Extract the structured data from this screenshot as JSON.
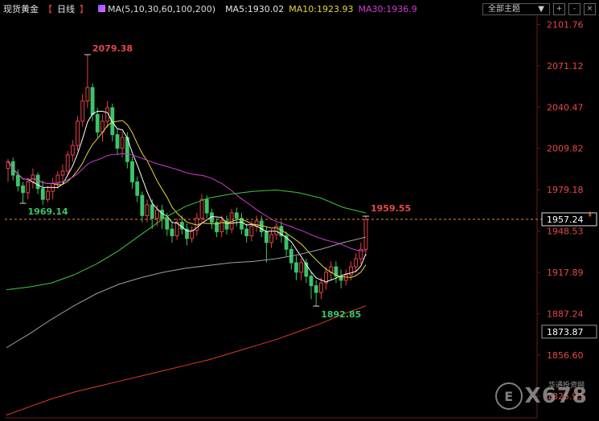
{
  "header": {
    "title": "现货黄金",
    "period": "日线",
    "ma_label": "MA(5,10,30,60,100,200)",
    "ma5": "MA5:1930.02",
    "ma10": "MA10:1923.93",
    "ma30": "MA30:1936.9",
    "theme_select": "全部主题",
    "theme_arrow": "▼"
  },
  "buttons": {
    "zoom_in": "+",
    "zoom_out": "-",
    "close": "×"
  },
  "colors": {
    "up": "#e8414a",
    "down": "#3cc46a",
    "ma5": "#ffffff",
    "ma10": "#e6d63c",
    "ma30": "#d23cd2",
    "ma60": "#3ec83e",
    "ma100": "#a0a0a0",
    "ma200": "#e03a2a"
  },
  "watermark": {
    "main": "X678",
    "sub": "华通投资网",
    "site": "www.ebaiyin.com"
  },
  "chart_data": {
    "type": "candlestick",
    "yaxis_ticks": [
      "2101.76",
      "2071.12",
      "2040.47",
      "2009.82",
      "1979.18",
      "1948.53",
      "1917.89",
      "1887.24",
      "1856.60",
      "1825.95"
    ],
    "ylim": [
      1810,
      2108
    ],
    "current_price": "1957.24",
    "extra_price_tag": "1873.87",
    "annotations": [
      {
        "text": "2079.38",
        "kind": "high"
      },
      {
        "text": "1969.14",
        "kind": "low"
      },
      {
        "text": "1959.55",
        "kind": "high"
      },
      {
        "text": "1892.85",
        "kind": "low"
      }
    ],
    "candles": [
      [
        1995,
        2000,
        1985,
        2002
      ],
      [
        2000,
        1990,
        1986,
        2003
      ],
      [
        1990,
        1982,
        1978,
        1994
      ],
      [
        1982,
        1977,
        1969,
        1985
      ],
      [
        1977,
        1985,
        1972,
        1988
      ],
      [
        1985,
        1990,
        1980,
        1995
      ],
      [
        1990,
        1980,
        1976,
        1992
      ],
      [
        1980,
        1972,
        1968,
        1986
      ],
      [
        1972,
        1978,
        1970,
        1982
      ],
      [
        1978,
        1984,
        1972,
        1988
      ],
      [
        1984,
        1990,
        1980,
        1993
      ],
      [
        1990,
        1993,
        1984,
        1998
      ],
      [
        1993,
        2005,
        1990,
        2008
      ],
      [
        2005,
        2012,
        2000,
        2016
      ],
      [
        2012,
        2030,
        2008,
        2034
      ],
      [
        2030,
        2045,
        2026,
        2050
      ],
      [
        2045,
        2055,
        2040,
        2079
      ],
      [
        2055,
        2035,
        2030,
        2058
      ],
      [
        2035,
        2022,
        2018,
        2040
      ],
      [
        2022,
        2030,
        2015,
        2035
      ],
      [
        2030,
        2040,
        2025,
        2045
      ],
      [
        2040,
        2020,
        2015,
        2043
      ],
      [
        2020,
        2010,
        2005,
        2024
      ],
      [
        2010,
        2018,
        2003,
        2022
      ],
      [
        2018,
        2000,
        1995,
        2022
      ],
      [
        2000,
        1985,
        1980,
        2004
      ],
      [
        1985,
        1975,
        1970,
        1989
      ],
      [
        1975,
        1960,
        1955,
        1978
      ],
      [
        1960,
        1968,
        1955,
        1972
      ],
      [
        1968,
        1958,
        1950,
        1972
      ],
      [
        1958,
        1964,
        1952,
        1968
      ],
      [
        1964,
        1958,
        1950,
        1968
      ],
      [
        1958,
        1950,
        1945,
        1962
      ],
      [
        1950,
        1945,
        1940,
        1955
      ],
      [
        1945,
        1955,
        1942,
        1958
      ],
      [
        1955,
        1950,
        1946,
        1960
      ],
      [
        1950,
        1943,
        1938,
        1954
      ],
      [
        1943,
        1949,
        1940,
        1952
      ],
      [
        1949,
        1958,
        1945,
        1962
      ],
      [
        1958,
        1972,
        1955,
        1976
      ],
      [
        1972,
        1962,
        1958,
        1975
      ],
      [
        1962,
        1955,
        1950,
        1965
      ],
      [
        1955,
        1948,
        1944,
        1958
      ],
      [
        1948,
        1956,
        1944,
        1960
      ],
      [
        1956,
        1950,
        1946,
        1960
      ],
      [
        1950,
        1962,
        1947,
        1965
      ],
      [
        1962,
        1958,
        1952,
        1966
      ],
      [
        1958,
        1950,
        1946,
        1962
      ],
      [
        1950,
        1945,
        1940,
        1954
      ],
      [
        1945,
        1952,
        1941,
        1956
      ],
      [
        1952,
        1956,
        1948,
        1960
      ],
      [
        1956,
        1948,
        1944,
        1960
      ],
      [
        1948,
        1940,
        1925,
        1952
      ],
      [
        1940,
        1946,
        1936,
        1950
      ],
      [
        1946,
        1952,
        1942,
        1955
      ],
      [
        1952,
        1945,
        1940,
        1956
      ],
      [
        1945,
        1935,
        1930,
        1948
      ],
      [
        1935,
        1925,
        1920,
        1938
      ],
      [
        1925,
        1918,
        1912,
        1930
      ],
      [
        1918,
        1925,
        1912,
        1928
      ],
      [
        1925,
        1915,
        1910,
        1928
      ],
      [
        1915,
        1908,
        1898,
        1918
      ],
      [
        1908,
        1903,
        1893,
        1912
      ],
      [
        1903,
        1910,
        1898,
        1914
      ],
      [
        1910,
        1918,
        1905,
        1922
      ],
      [
        1918,
        1922,
        1912,
        1926
      ],
      [
        1922,
        1915,
        1910,
        1926
      ],
      [
        1915,
        1912,
        1906,
        1920
      ],
      [
        1912,
        1916,
        1908,
        1920
      ],
      [
        1916,
        1922,
        1912,
        1926
      ],
      [
        1922,
        1928,
        1918,
        1932
      ],
      [
        1928,
        1935,
        1924,
        1940
      ],
      [
        1935,
        1957,
        1930,
        1960
      ]
    ]
  }
}
